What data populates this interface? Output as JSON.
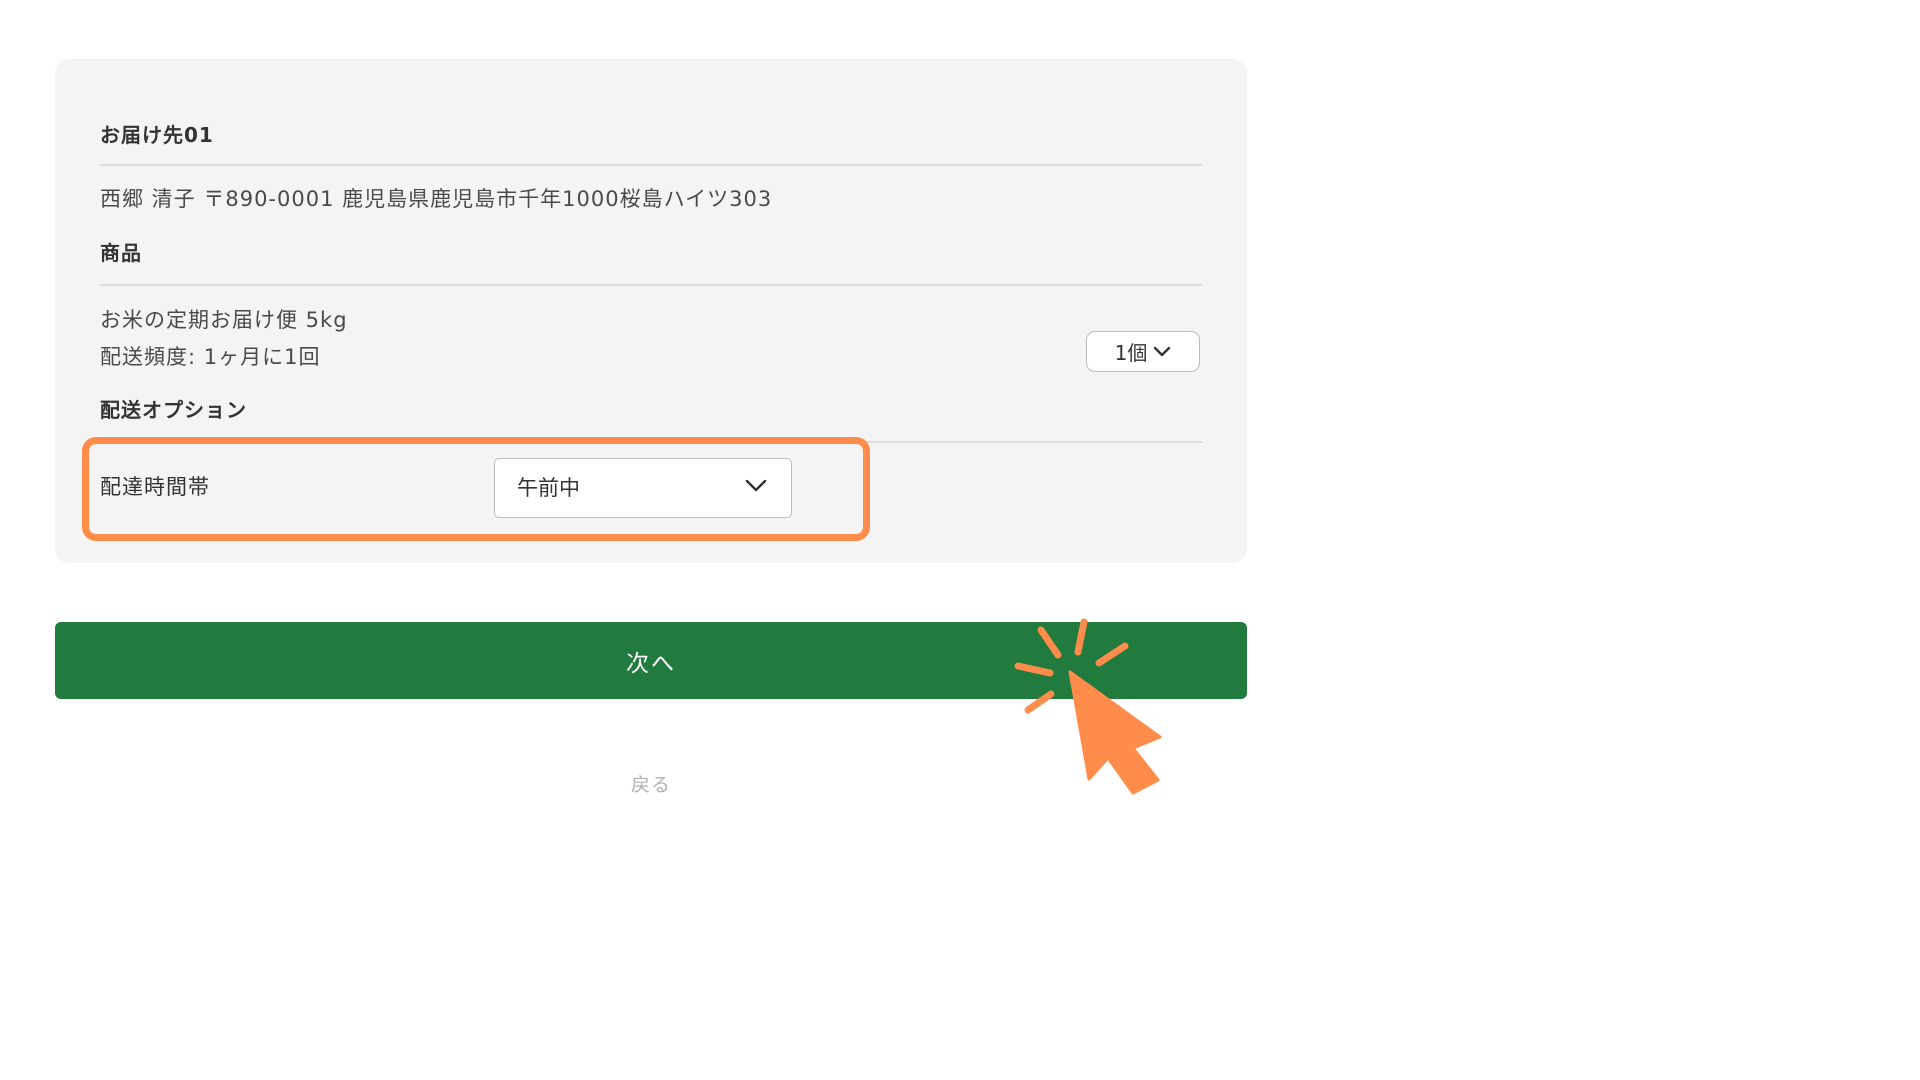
{
  "delivery": {
    "section_title": "お届け先01",
    "address": "西郷 清子 〒890-0001 鹿児島県鹿児島市千年1000桜島ハイツ303"
  },
  "product": {
    "section_title": "商品",
    "name": "お米の定期お届け便 5kg",
    "frequency": "配送頻度: 1ヶ月に1回",
    "quantity": "1個"
  },
  "options": {
    "section_title": "配送オプション",
    "time_slot_label": "配達時間帯",
    "time_slot_value": "午前中"
  },
  "actions": {
    "next_label": "次へ",
    "back_label": "戻る"
  },
  "colors": {
    "primary_button": "#217a3e",
    "highlight": "#ff8c4a",
    "card_background": "#f4f4f4"
  },
  "icons": {
    "quantity_dropdown": "chevron-down-icon",
    "time_dropdown": "chevron-down-icon",
    "click_indicator": "pointer-click-icon"
  }
}
